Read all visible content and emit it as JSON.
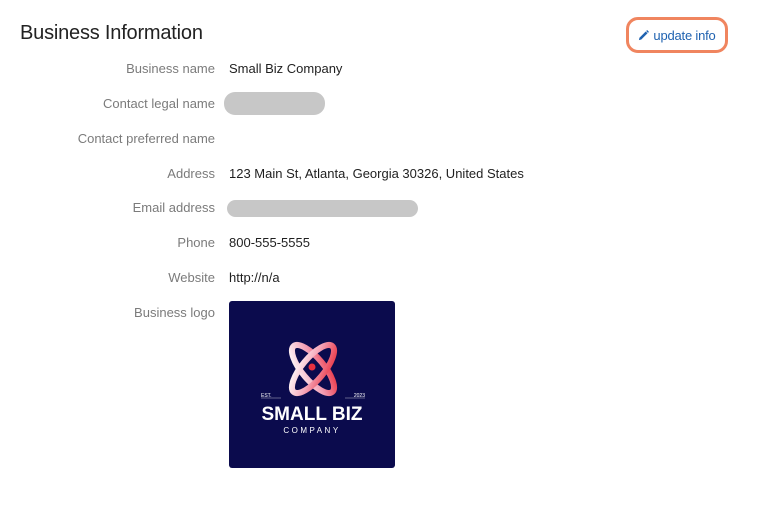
{
  "section": {
    "title": "Business Information",
    "update_label": "update info"
  },
  "fields": [
    {
      "label": "Business name",
      "value": "Small Biz Company"
    },
    {
      "label": "Contact legal name",
      "value": ""
    },
    {
      "label": "Contact preferred name",
      "value": ""
    },
    {
      "label": "Address",
      "value": "123 Main St, Atlanta, Georgia 30326, United States"
    },
    {
      "label": "Email address",
      "value": ""
    },
    {
      "label": "Phone",
      "value": "800-555-5555"
    },
    {
      "label": "Website",
      "value": "http://n/a"
    },
    {
      "label": "Business logo",
      "value": ""
    }
  ],
  "logo": {
    "est_label": "EST.",
    "year": "2023",
    "name_line1": "SMALL BIZ",
    "name_line2": "COMPANY"
  },
  "colors": {
    "accent_link": "#1f62b0",
    "highlight_ring": "#f0855f",
    "logo_background": "#0b0b4d",
    "redaction": "#c7c7c7"
  },
  "icons": {
    "edit": "pencil-icon"
  }
}
